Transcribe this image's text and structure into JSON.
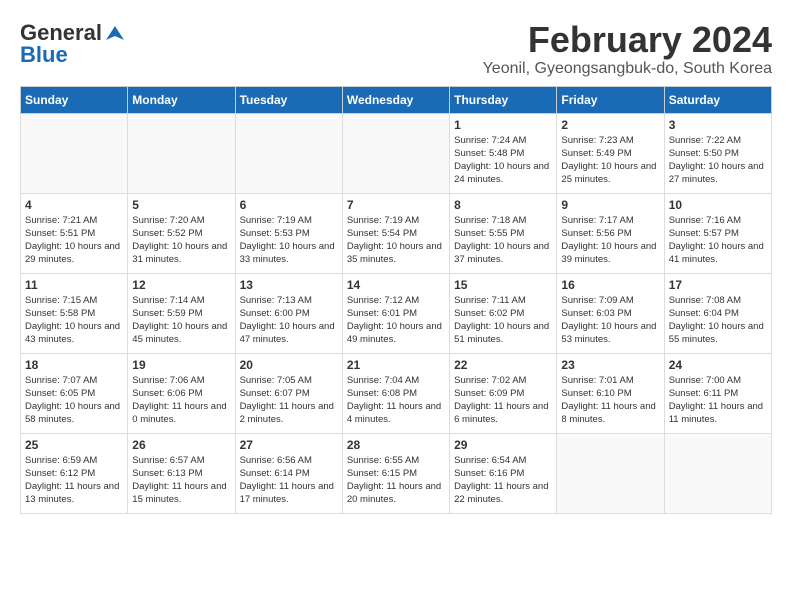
{
  "header": {
    "logo_general": "General",
    "logo_blue": "Blue",
    "month_title": "February 2024",
    "location": "Yeonil, Gyeongsangbuk-do, South Korea"
  },
  "days_of_week": [
    "Sunday",
    "Monday",
    "Tuesday",
    "Wednesday",
    "Thursday",
    "Friday",
    "Saturday"
  ],
  "weeks": [
    [
      {
        "day": "",
        "empty": true
      },
      {
        "day": "",
        "empty": true
      },
      {
        "day": "",
        "empty": true
      },
      {
        "day": "",
        "empty": true
      },
      {
        "day": "1",
        "sunrise": "7:24 AM",
        "sunset": "5:48 PM",
        "daylight": "10 hours and 24 minutes."
      },
      {
        "day": "2",
        "sunrise": "7:23 AM",
        "sunset": "5:49 PM",
        "daylight": "10 hours and 25 minutes."
      },
      {
        "day": "3",
        "sunrise": "7:22 AM",
        "sunset": "5:50 PM",
        "daylight": "10 hours and 27 minutes."
      }
    ],
    [
      {
        "day": "4",
        "sunrise": "7:21 AM",
        "sunset": "5:51 PM",
        "daylight": "10 hours and 29 minutes."
      },
      {
        "day": "5",
        "sunrise": "7:20 AM",
        "sunset": "5:52 PM",
        "daylight": "10 hours and 31 minutes."
      },
      {
        "day": "6",
        "sunrise": "7:19 AM",
        "sunset": "5:53 PM",
        "daylight": "10 hours and 33 minutes."
      },
      {
        "day": "7",
        "sunrise": "7:19 AM",
        "sunset": "5:54 PM",
        "daylight": "10 hours and 35 minutes."
      },
      {
        "day": "8",
        "sunrise": "7:18 AM",
        "sunset": "5:55 PM",
        "daylight": "10 hours and 37 minutes."
      },
      {
        "day": "9",
        "sunrise": "7:17 AM",
        "sunset": "5:56 PM",
        "daylight": "10 hours and 39 minutes."
      },
      {
        "day": "10",
        "sunrise": "7:16 AM",
        "sunset": "5:57 PM",
        "daylight": "10 hours and 41 minutes."
      }
    ],
    [
      {
        "day": "11",
        "sunrise": "7:15 AM",
        "sunset": "5:58 PM",
        "daylight": "10 hours and 43 minutes."
      },
      {
        "day": "12",
        "sunrise": "7:14 AM",
        "sunset": "5:59 PM",
        "daylight": "10 hours and 45 minutes."
      },
      {
        "day": "13",
        "sunrise": "7:13 AM",
        "sunset": "6:00 PM",
        "daylight": "10 hours and 47 minutes."
      },
      {
        "day": "14",
        "sunrise": "7:12 AM",
        "sunset": "6:01 PM",
        "daylight": "10 hours and 49 minutes."
      },
      {
        "day": "15",
        "sunrise": "7:11 AM",
        "sunset": "6:02 PM",
        "daylight": "10 hours and 51 minutes."
      },
      {
        "day": "16",
        "sunrise": "7:09 AM",
        "sunset": "6:03 PM",
        "daylight": "10 hours and 53 minutes."
      },
      {
        "day": "17",
        "sunrise": "7:08 AM",
        "sunset": "6:04 PM",
        "daylight": "10 hours and 55 minutes."
      }
    ],
    [
      {
        "day": "18",
        "sunrise": "7:07 AM",
        "sunset": "6:05 PM",
        "daylight": "10 hours and 58 minutes."
      },
      {
        "day": "19",
        "sunrise": "7:06 AM",
        "sunset": "6:06 PM",
        "daylight": "11 hours and 0 minutes."
      },
      {
        "day": "20",
        "sunrise": "7:05 AM",
        "sunset": "6:07 PM",
        "daylight": "11 hours and 2 minutes."
      },
      {
        "day": "21",
        "sunrise": "7:04 AM",
        "sunset": "6:08 PM",
        "daylight": "11 hours and 4 minutes."
      },
      {
        "day": "22",
        "sunrise": "7:02 AM",
        "sunset": "6:09 PM",
        "daylight": "11 hours and 6 minutes."
      },
      {
        "day": "23",
        "sunrise": "7:01 AM",
        "sunset": "6:10 PM",
        "daylight": "11 hours and 8 minutes."
      },
      {
        "day": "24",
        "sunrise": "7:00 AM",
        "sunset": "6:11 PM",
        "daylight": "11 hours and 11 minutes."
      }
    ],
    [
      {
        "day": "25",
        "sunrise": "6:59 AM",
        "sunset": "6:12 PM",
        "daylight": "11 hours and 13 minutes."
      },
      {
        "day": "26",
        "sunrise": "6:57 AM",
        "sunset": "6:13 PM",
        "daylight": "11 hours and 15 minutes."
      },
      {
        "day": "27",
        "sunrise": "6:56 AM",
        "sunset": "6:14 PM",
        "daylight": "11 hours and 17 minutes."
      },
      {
        "day": "28",
        "sunrise": "6:55 AM",
        "sunset": "6:15 PM",
        "daylight": "11 hours and 20 minutes."
      },
      {
        "day": "29",
        "sunrise": "6:54 AM",
        "sunset": "6:16 PM",
        "daylight": "11 hours and 22 minutes."
      },
      {
        "day": "",
        "empty": true
      },
      {
        "day": "",
        "empty": true
      }
    ]
  ]
}
